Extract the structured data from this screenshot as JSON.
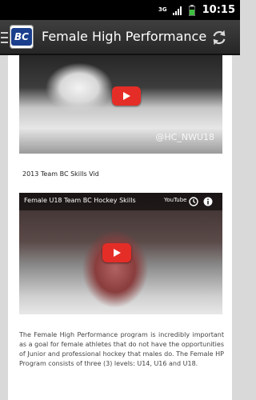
{
  "status_bar": {
    "network": "3G",
    "time": "10:15"
  },
  "app_bar": {
    "logo_text": "BC",
    "title": "Female High Performance"
  },
  "videos": [
    {
      "watermark": "@HC_NWU18"
    },
    {
      "caption": "Female U18 Team BC Hockey Skills",
      "player_label": "YouTube"
    }
  ],
  "section_title": "2013 Team BC Skills Vid",
  "description": "The Female High Performance program is incredibly important as a goal for female athletes that do not have the opportunities of Junior and professional hockey that males do.  The Female HP Program consists of three (3) levels: U14, U16 and U18."
}
